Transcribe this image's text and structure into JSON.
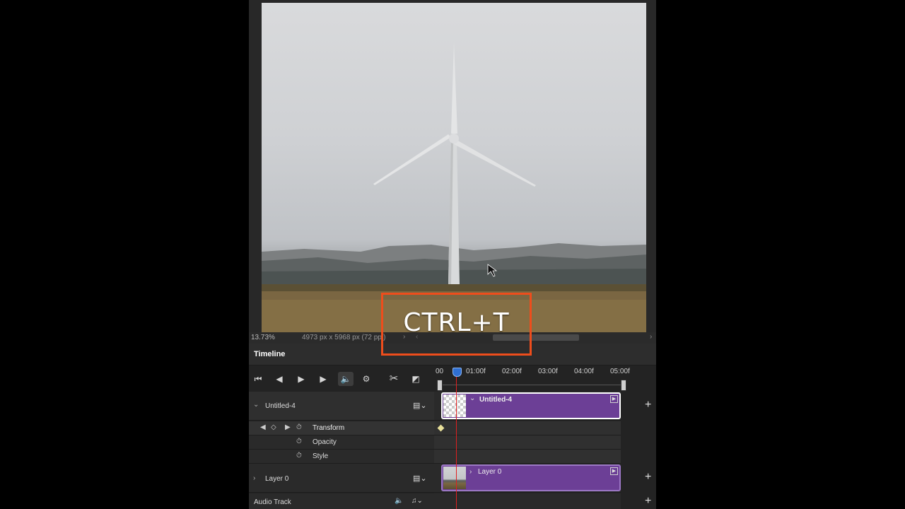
{
  "status": {
    "zoom": "13.73%",
    "doc_info": "4973 px x 5968 px (72 ppi)"
  },
  "panel": {
    "tab_label": "Timeline"
  },
  "overlay": {
    "shortcut_text": "CTRL+T",
    "accent_color": "#ee4d1c"
  },
  "ruler": {
    "ticks": [
      "00",
      "01:00f",
      "02:00f",
      "03:00f",
      "04:00f",
      "05:00f"
    ]
  },
  "tracks": {
    "group": {
      "name": "Untitled-4",
      "clip_name": "Untitled-4"
    },
    "properties": [
      "Transform",
      "Opacity",
      "Style"
    ],
    "layer": {
      "name": "Layer 0",
      "clip_name": "Layer 0"
    },
    "audio": {
      "name": "Audio Track"
    }
  },
  "colors": {
    "clip_fill": "#6c3f96",
    "playhead": "#e02020",
    "panel_bg": "#232323"
  }
}
